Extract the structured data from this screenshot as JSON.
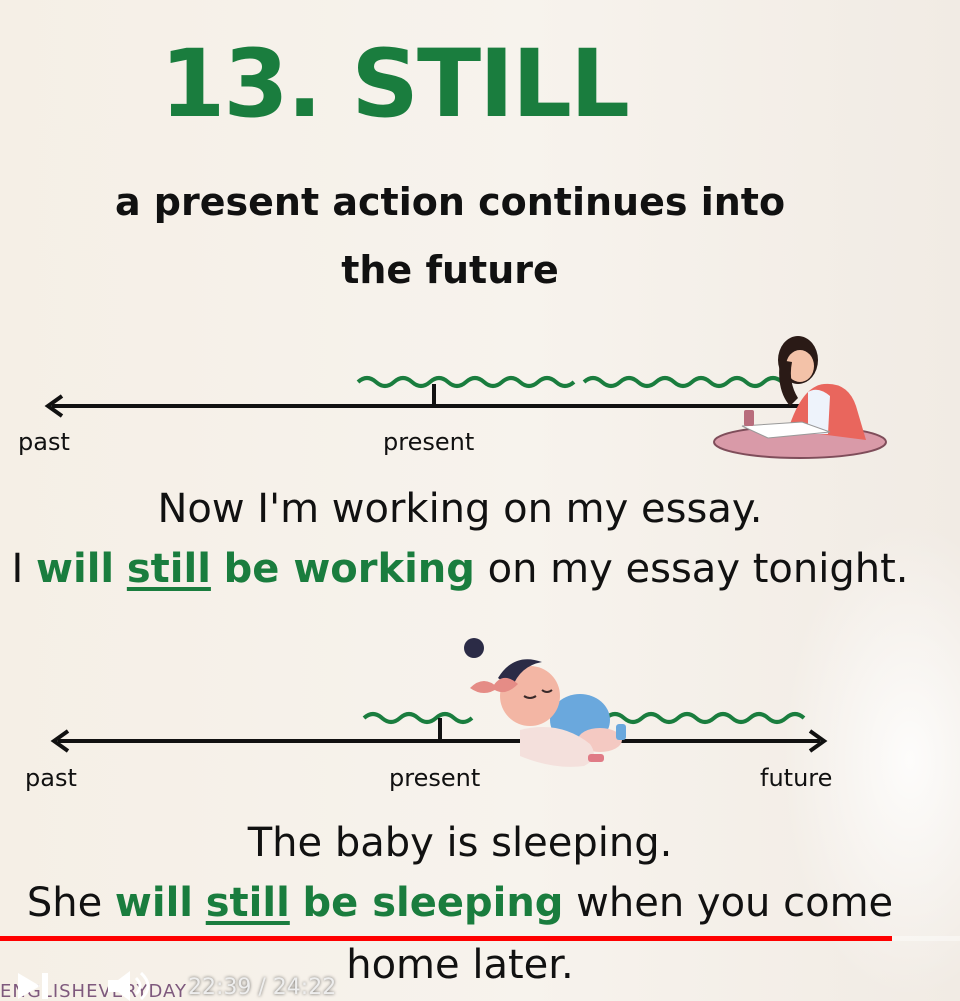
{
  "slide": {
    "title": "13. STILL",
    "subtitle_line1": "a present action continues into",
    "subtitle_line2": "the future"
  },
  "timeline1": {
    "past_label": "past",
    "present_label": "present"
  },
  "example1": {
    "line1": "Now I'm working on my essay.",
    "pre": "I ",
    "will": "will",
    "still": "still",
    "be_verb": "be working",
    "post": " on my essay tonight."
  },
  "timeline2": {
    "past_label": "past",
    "present_label": "present",
    "future_label": "future"
  },
  "example2": {
    "line1": "The baby is sleeping.",
    "pre": "She ",
    "will": "will",
    "still": "still",
    "be_verb": "be sleeping",
    "post": " when you come",
    "line3": "home later."
  },
  "player": {
    "current_time": "22:39",
    "duration": "24:22",
    "time_display": "22:39 / 24:22",
    "progress": 0.929,
    "watermark": "ENGLISHEVERYDAY",
    "progress_color": "#ff0000"
  },
  "colors": {
    "accent_green": "#1a7d3e",
    "text": "#111111"
  }
}
